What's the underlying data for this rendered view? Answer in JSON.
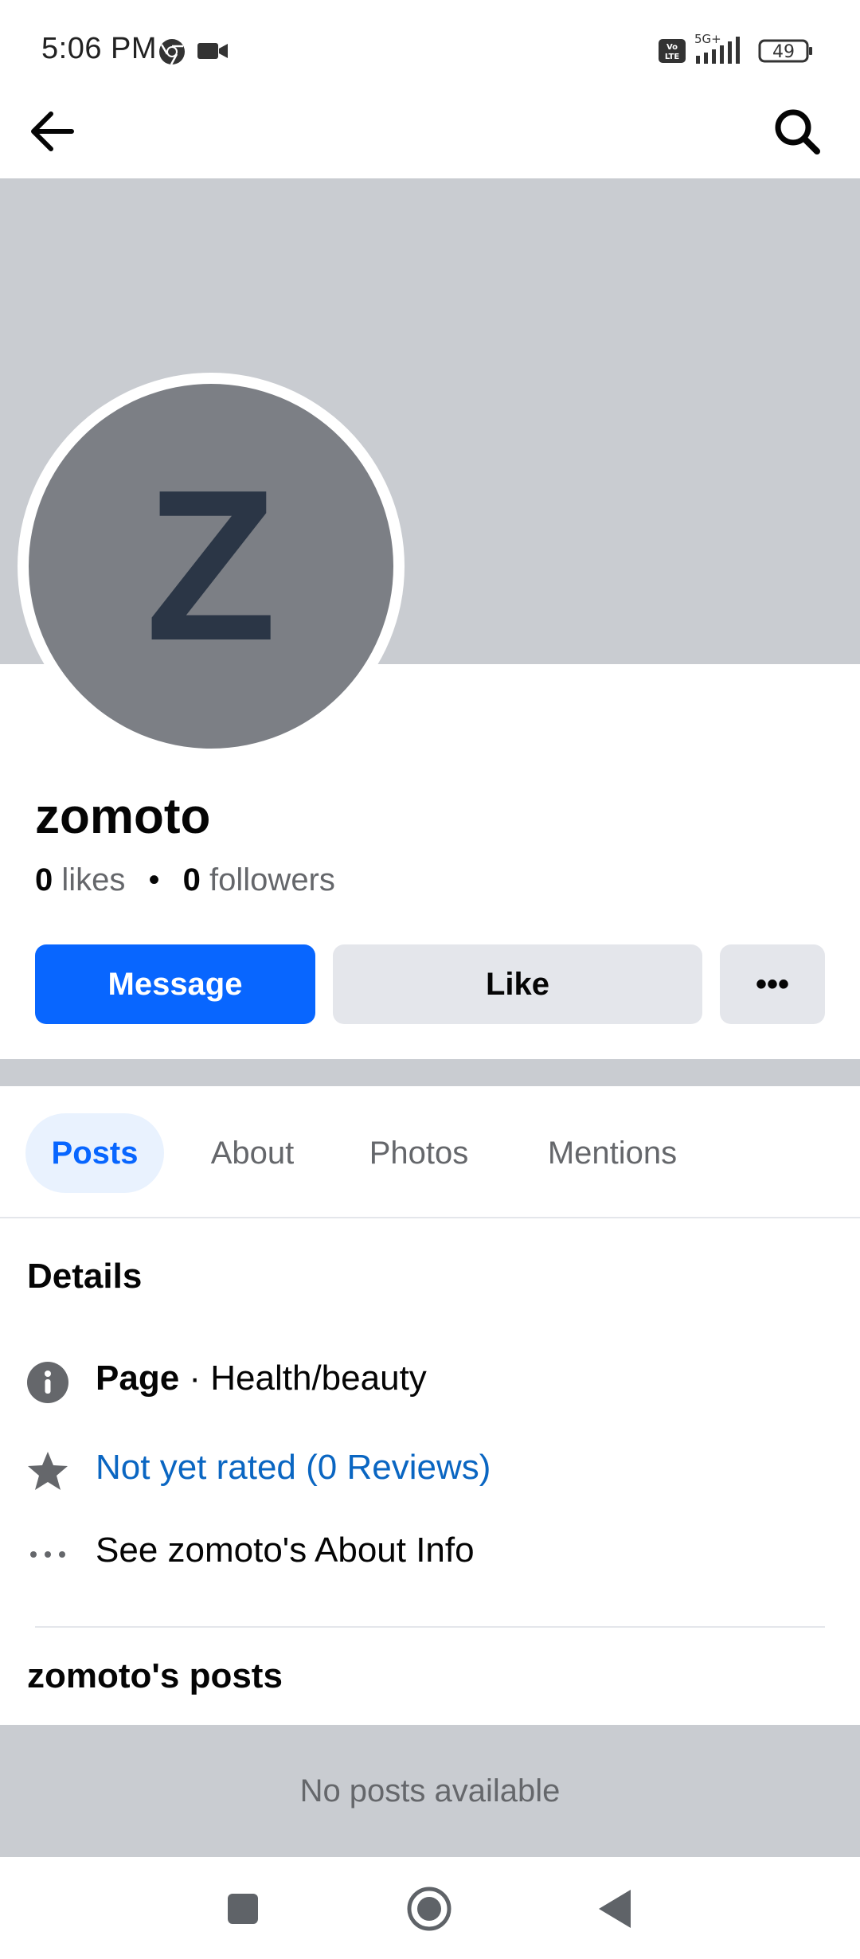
{
  "status_bar": {
    "time": "5:06 PM",
    "battery": "49",
    "network": "5G+",
    "icons": [
      "chrome-icon",
      "video-camera-icon",
      "volte-icon",
      "signal-icon",
      "battery-icon"
    ]
  },
  "topbar": {
    "icons": [
      "back-arrow-icon",
      "search-icon"
    ]
  },
  "profile": {
    "avatar_letter": "Z",
    "name": "zomoto",
    "likes_count": "0",
    "likes_label": "likes",
    "followers_count": "0",
    "followers_label": "followers",
    "separator": "•"
  },
  "actions": {
    "message_label": "Message",
    "like_label": "Like",
    "more_label": "•••"
  },
  "tabs": [
    {
      "label": "Posts",
      "active": true
    },
    {
      "label": "About",
      "active": false
    },
    {
      "label": "Photos",
      "active": false
    },
    {
      "label": "Mentions",
      "active": false
    }
  ],
  "details": {
    "title": "Details",
    "page_label": "Page",
    "page_category": " · Health/beauty",
    "rating_text": "Not yet rated (0 Reviews)",
    "about_link": "See zomoto's About Info"
  },
  "posts": {
    "title": "zomoto's posts",
    "empty_text": "No posts available"
  },
  "colors": {
    "primary": "#0866ff",
    "link": "#0a66c2",
    "cover": "#c9ccd1",
    "avatar": "#7c7f85",
    "avatar_letter": "#2b3646",
    "secondary_button": "#e4e6eb"
  }
}
